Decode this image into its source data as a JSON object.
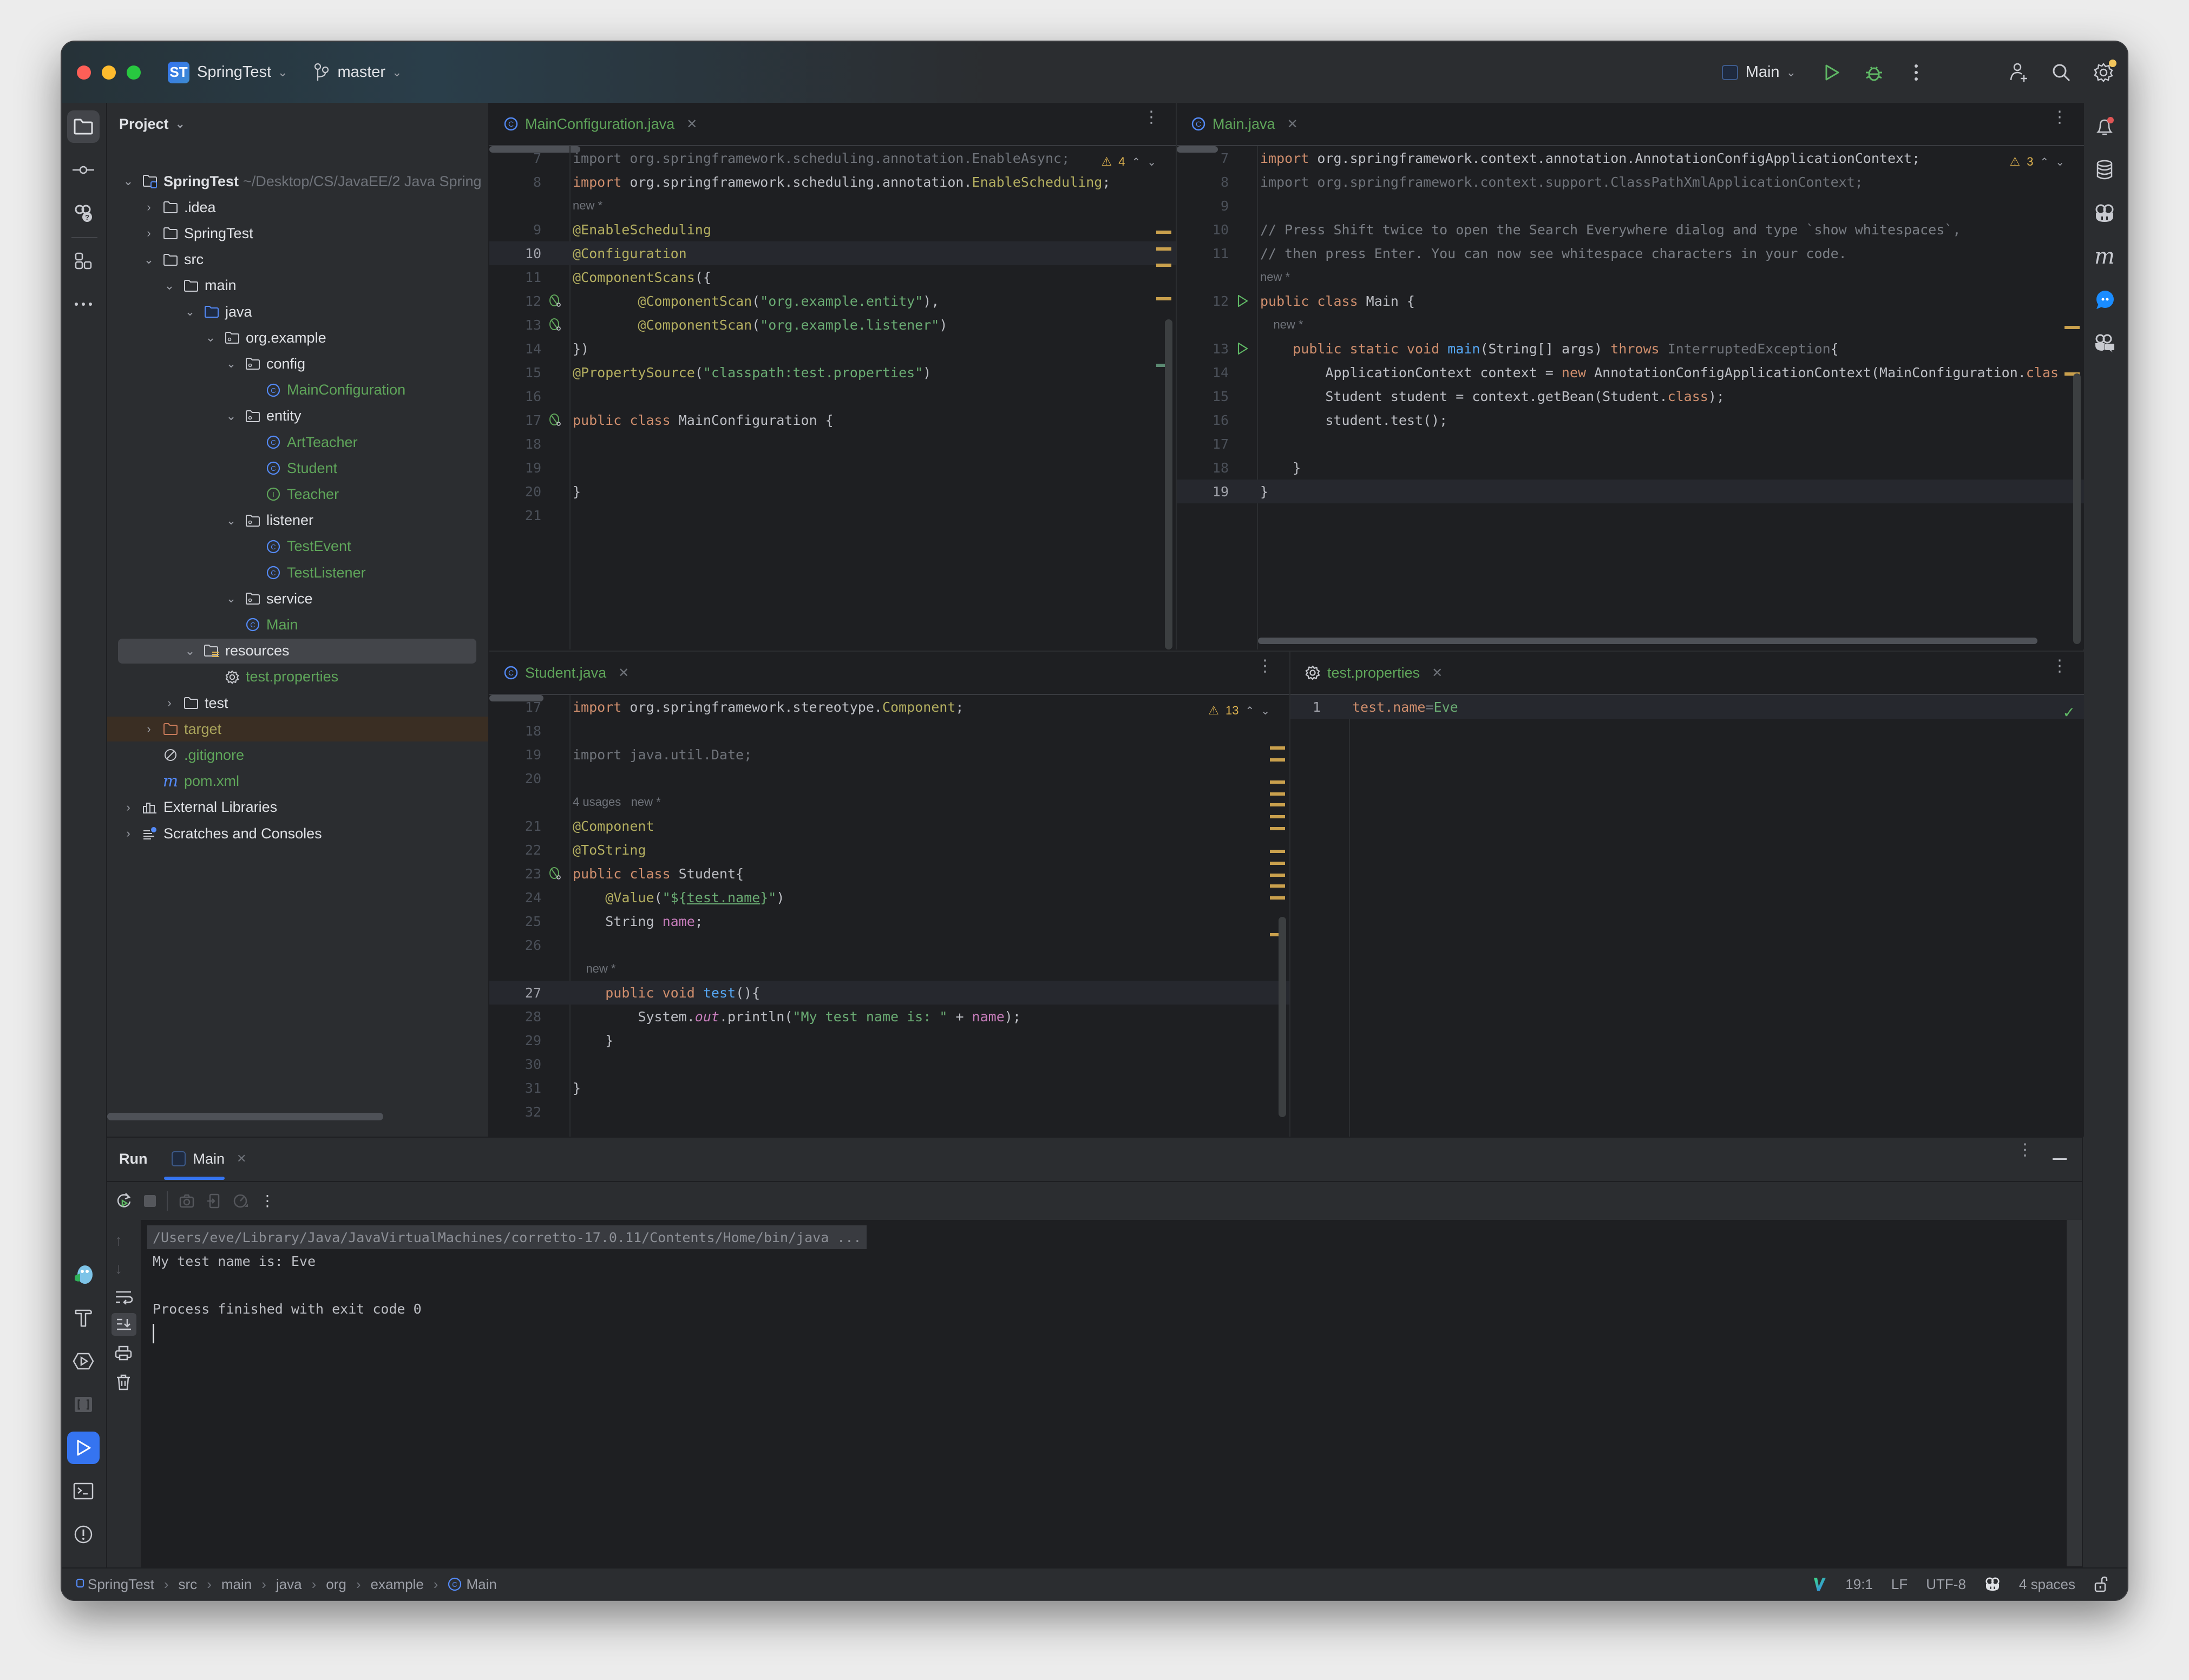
{
  "titlebar": {
    "project_badge": "ST",
    "project_name": "SpringTest",
    "branch": "master",
    "run_config": "Main",
    "icons": [
      "run-icon",
      "debug-icon",
      "more-icon",
      "add-user-icon",
      "search-icon",
      "settings-icon"
    ]
  },
  "left_strip": {
    "top": [
      "project-icon",
      "commit-icon",
      "ai-help-icon",
      "structure-icon",
      "more-icon"
    ],
    "bottom": [
      "plugin-icon",
      "build-icon",
      "services-icon",
      "bracket-icon",
      "run-icon",
      "terminal-icon",
      "problems-icon",
      "git-icon"
    ]
  },
  "right_strip": [
    "notifications-icon",
    "database-icon",
    "copilot-icon",
    "maven-icon",
    "chat-icon",
    "copilot-chat-icon"
  ],
  "project": {
    "header": "Project",
    "tree": [
      {
        "label": "SpringTest",
        "suffix": "~/Desktop/CS/JavaEE/2 Java Spring",
        "depth": 0,
        "arrow": "open",
        "icon": "module-folder",
        "bold": true
      },
      {
        "label": ".idea",
        "depth": 1,
        "arrow": "closed",
        "icon": "folder"
      },
      {
        "label": "SpringTest",
        "depth": 1,
        "arrow": "closed",
        "icon": "folder"
      },
      {
        "label": "src",
        "depth": 1,
        "arrow": "open",
        "icon": "folder"
      },
      {
        "label": "main",
        "depth": 2,
        "arrow": "open",
        "icon": "folder"
      },
      {
        "label": "java",
        "depth": 3,
        "arrow": "open",
        "icon": "source-folder"
      },
      {
        "label": "org.example",
        "depth": 4,
        "arrow": "open",
        "icon": "package"
      },
      {
        "label": "config",
        "depth": 5,
        "arrow": "open",
        "icon": "package"
      },
      {
        "label": "MainConfiguration",
        "depth": 6,
        "arrow": "none",
        "icon": "class",
        "color": "green"
      },
      {
        "label": "entity",
        "depth": 5,
        "arrow": "open",
        "icon": "package"
      },
      {
        "label": "ArtTeacher",
        "depth": 6,
        "arrow": "none",
        "icon": "class",
        "color": "green"
      },
      {
        "label": "Student",
        "depth": 6,
        "arrow": "none",
        "icon": "class",
        "color": "green"
      },
      {
        "label": "Teacher",
        "depth": 6,
        "arrow": "none",
        "icon": "interface",
        "color": "green"
      },
      {
        "label": "listener",
        "depth": 5,
        "arrow": "open",
        "icon": "package"
      },
      {
        "label": "TestEvent",
        "depth": 6,
        "arrow": "none",
        "icon": "class",
        "color": "green"
      },
      {
        "label": "TestListener",
        "depth": 6,
        "arrow": "none",
        "icon": "class",
        "color": "green"
      },
      {
        "label": "service",
        "depth": 5,
        "arrow": "open",
        "icon": "package"
      },
      {
        "label": "Main",
        "depth": 5,
        "arrow": "none",
        "icon": "class",
        "color": "green"
      },
      {
        "label": "resources",
        "depth": 3,
        "arrow": "open",
        "icon": "resources-folder",
        "selected": true
      },
      {
        "label": "test.properties",
        "depth": 4,
        "arrow": "none",
        "icon": "properties",
        "color": "green"
      },
      {
        "label": "test",
        "depth": 2,
        "arrow": "closed",
        "icon": "folder"
      },
      {
        "label": "target",
        "depth": 1,
        "arrow": "closed",
        "icon": "excluded-folder",
        "color": "olive",
        "excluded": true
      },
      {
        "label": ".gitignore",
        "depth": 1,
        "arrow": "none",
        "icon": "ignore",
        "color": "green"
      },
      {
        "label": "pom.xml",
        "depth": 1,
        "arrow": "none",
        "icon": "maven",
        "color": "green"
      },
      {
        "label": "External Libraries",
        "depth": 0,
        "arrow": "closed",
        "icon": "libraries"
      },
      {
        "label": "Scratches and Consoles",
        "depth": 0,
        "arrow": "closed",
        "icon": "scratches"
      }
    ]
  },
  "editors": {
    "main_configuration": {
      "tab": "MainConfiguration.java",
      "warnings": "4",
      "lines": [
        {
          "n": "7",
          "html": "<span class='unused'>import org.springframework.scheduling.annotation.EnableAsync;</span>"
        },
        {
          "n": "8",
          "html": "<span class='kw'>import</span> org.springframework.scheduling.annotation.<span class='ann'>EnableScheduling</span>;"
        },
        {
          "n": "",
          "hint": "new *"
        },
        {
          "n": "9",
          "html": "<span class='ann'>@EnableScheduling</span>"
        },
        {
          "n": "10",
          "html": "<span class='ann'>@Configuration</span>",
          "current": true
        },
        {
          "n": "11",
          "html": "<span class='ann'>@ComponentScans</span>({"
        },
        {
          "n": "12",
          "gicon": "bean",
          "html": "        <span class='ann'>@ComponentScan</span>(<span class='str'>\"org.example.entity\"</span>),"
        },
        {
          "n": "13",
          "gicon": "bean",
          "html": "        <span class='ann'>@ComponentScan</span>(<span class='str'>\"org.example.listener\"</span>)"
        },
        {
          "n": "14",
          "html": "})"
        },
        {
          "n": "15",
          "html": "<span class='ann'>@PropertySource</span>(<span class='str'>\"classpath:test.properties\"</span>)"
        },
        {
          "n": "16",
          "html": ""
        },
        {
          "n": "17",
          "gicon": "bean",
          "html": "<span class='kw'>public class</span> MainConfiguration {"
        },
        {
          "n": "18",
          "html": ""
        },
        {
          "n": "19",
          "html": ""
        },
        {
          "n": "20",
          "html": "}"
        },
        {
          "n": "21",
          "html": ""
        }
      ]
    },
    "main": {
      "tab": "Main.java",
      "warnings": "3",
      "lines": [
        {
          "n": "7",
          "html": "<span class='kw'>import</span> org.springframework.context.annotation.AnnotationConfigApplicationContext;"
        },
        {
          "n": "8",
          "html": "<span class='unused'>import org.springframework.context.support.ClassPathXmlApplicationContext;</span>"
        },
        {
          "n": "9",
          "html": ""
        },
        {
          "n": "10",
          "html": "<span class='cmt'>// Press Shift twice to open the Search Everywhere dialog and type `show whitespaces`,</span>"
        },
        {
          "n": "11",
          "html": "<span class='cmt'>// then press Enter. You can now see whitespace characters in your code.</span>"
        },
        {
          "n": "",
          "hint": "new *"
        },
        {
          "n": "12",
          "gicon": "run",
          "html": "<span class='kw'>public class</span> Main {"
        },
        {
          "n": "",
          "hint": "    new *"
        },
        {
          "n": "13",
          "gicon": "run",
          "html": "    <span class='kw'>public static void</span> <span class='fn'>main</span>(String[] args) <span class='kw'>throws</span> <span class='unused'>InterruptedException</span>{"
        },
        {
          "n": "14",
          "html": "        ApplicationContext context = <span class='kw'>new</span> AnnotationConfigApplicationContext(MainConfiguration.<span class='kw'>clas</span>"
        },
        {
          "n": "15",
          "html": "        Student student = context.getBean(Student.<span class='kw'>class</span>);"
        },
        {
          "n": "16",
          "html": "        student.test();"
        },
        {
          "n": "17",
          "html": ""
        },
        {
          "n": "18",
          "html": "    }"
        },
        {
          "n": "19",
          "html": "}",
          "current": true
        }
      ]
    },
    "student": {
      "tab": "Student.java",
      "warnings": "13",
      "lines": [
        {
          "n": "17",
          "html": "<span class='kw'>import</span> org.springframework.stereotype.<span class='ann'>Component</span>;"
        },
        {
          "n": "18",
          "html": ""
        },
        {
          "n": "19",
          "html": "<span class='unused'>import java.util.Date;</span>"
        },
        {
          "n": "20",
          "html": ""
        },
        {
          "n": "",
          "hint": "4 usages   new *"
        },
        {
          "n": "21",
          "html": "<span class='ann'>@Component</span>"
        },
        {
          "n": "22",
          "html": "<span class='ann'>@ToString</span>"
        },
        {
          "n": "23",
          "gicon": "bean",
          "html": "<span class='kw'>public class</span> Student{"
        },
        {
          "n": "24",
          "html": "    <span class='ann'>@Value</span>(<span class='str'>\"${<u>test.name</u>}\"</span>)"
        },
        {
          "n": "25",
          "html": "    String <span class='fld'>name</span>;"
        },
        {
          "n": "26",
          "html": ""
        },
        {
          "n": "",
          "hint": "    new *"
        },
        {
          "n": "27",
          "html": "    <span class='kw'>public void</span> <span class='fn'>test</span>(){",
          "current": true
        },
        {
          "n": "28",
          "html": "        System.<span class='fld it'>out</span>.println(<span class='str'>\"My test name is: \"</span> + <span class='fld'>name</span>);"
        },
        {
          "n": "29",
          "html": "    }"
        },
        {
          "n": "30",
          "html": ""
        },
        {
          "n": "31",
          "html": "}"
        },
        {
          "n": "32",
          "html": ""
        }
      ]
    },
    "properties": {
      "tab": "test.properties",
      "lines": [
        {
          "n": "1",
          "html": "<span class='kw'>test.name</span><span class='unused'>=</span><span class='str'>Eve</span>",
          "current": true
        }
      ]
    }
  },
  "run": {
    "title": "Run",
    "tab": "Main",
    "console": [
      "/Users/eve/Library/Java/JavaVirtualMachines/corretto-17.0.11/Contents/Home/bin/java ...",
      "My test name is: Eve",
      "",
      "Process finished with exit code 0"
    ]
  },
  "status": {
    "breadcrumb": [
      "SpringTest",
      "src",
      "main",
      "java",
      "org",
      "example",
      "Main"
    ],
    "position": "19:1",
    "line_ending": "LF",
    "encoding": "UTF-8",
    "indent": "4 spaces"
  },
  "colors": {
    "accent": "#3574f0",
    "keyword": "#cf8e6d",
    "annotation": "#b3ae60",
    "string": "#6aab73",
    "function": "#56a8f5",
    "field": "#c77dbb",
    "warning": "#e0b450",
    "run_green": "#5fb865"
  }
}
